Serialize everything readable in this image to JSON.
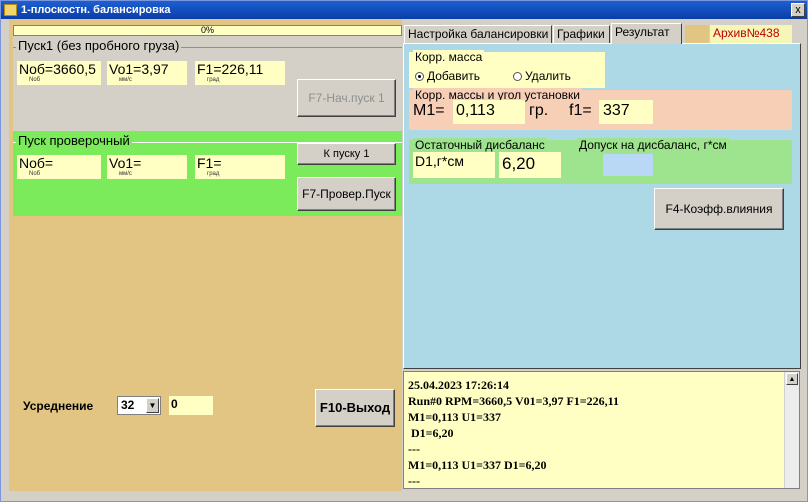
{
  "window": {
    "title": "1-плоскостн. балансировка",
    "close_label": "x"
  },
  "progress": {
    "value_text": "0%",
    "fraction": 0
  },
  "run1": {
    "title": "Пуск1 (без пробного груза)",
    "rpm_label": "Nоб=",
    "rpm_value": "3660,5",
    "rpm_sub": "Nоб",
    "v_label": "Vo1=",
    "v_value": "3,97",
    "v_sub": "мм/с",
    "f_label": "F1=",
    "f_value": "226,11",
    "f_sub": "град",
    "start_button": "F7-Нач.пуск 1"
  },
  "check_run": {
    "title": "Пуск проверочный",
    "rpm_label": "Nоб=",
    "rpm_sub": "Nоб",
    "v_label": "Vo1=",
    "v_sub": "мм/с",
    "f_label": "F1=",
    "f_sub": "град",
    "to_run1_button": "К пуску 1",
    "start_button": "F7-Провер.Пуск"
  },
  "averaging": {
    "label": "Усреднение",
    "selected": "32",
    "counter": "0"
  },
  "exit_button": "F10-Выход",
  "tabs": [
    {
      "label": "Настройка балансировки"
    },
    {
      "label": "Графики"
    },
    {
      "label": "Результат"
    }
  ],
  "archive_label": "Архив№438",
  "result": {
    "mass_group_title": "Корр. масса",
    "option_add": "Добавить",
    "option_remove": "Удалить",
    "selected_option": "Добавить",
    "angle_group_title": "Корр. массы и угол установки",
    "m1_label": "M1=",
    "m1_value": "0,113",
    "m1_unit": "гр.",
    "f1_label": "f1=",
    "f1_value": "337",
    "residual_title": "Остаточный дисбаланс",
    "tolerance_title": "Допуск на дисбаланс, г*см",
    "d1_label": "D1,г*см",
    "d1_value": "6,20",
    "tolerance_value": "",
    "influence_button": "F4-Коэфф.влияния"
  },
  "log": [
    "25.04.2023 17:26:14",
    "Run#0 RPM=3660,5 V01=3,97 F1=226,11",
    "M1=0,113 U1=337",
    " D1=6,20",
    "---",
    "M1=0,113 U1=337 D1=6,20",
    "---"
  ],
  "colors": {
    "left_bg": "#e2c582",
    "check_run_bg": "#7bea5b",
    "field_bg": "#ffffc4",
    "panel_bg": "#add8e6",
    "angle_bg": "#f7cfb7",
    "residual_bg": "#9ee38d",
    "archive_text": "#c00000"
  }
}
